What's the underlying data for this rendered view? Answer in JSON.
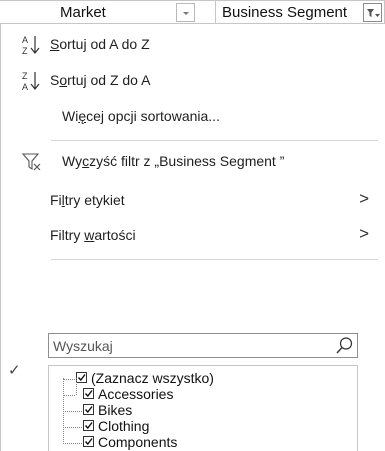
{
  "header": {
    "market_label": "Market",
    "segment_label": "Business Segment"
  },
  "menu": {
    "sort_az": {
      "pre": "",
      "acc": "S",
      "post": "ortuj od A do Z"
    },
    "sort_za": {
      "pre": "S",
      "acc": "o",
      "post": "rtuj od Z do A"
    },
    "more_sort": {
      "pre": "Wi",
      "acc": "ę",
      "post": "cej opcji sortowania..."
    },
    "clear_filter": {
      "pre": "Wy",
      "acc": "c",
      "post": "zyść filtr z „Business Segment ”"
    },
    "label_filters": {
      "pre": "Fi",
      "acc": "l",
      "post": "try etykiet"
    },
    "value_filters": {
      "pre": "Filtry ",
      "acc": "w",
      "post": "artości"
    },
    "chevron": ">"
  },
  "search": {
    "placeholder": "Wyszukaj"
  },
  "tree": {
    "checkmark": "✓",
    "items": [
      {
        "label": "(Zaznacz wszystko)",
        "checked": true
      },
      {
        "label": "Accessories",
        "checked": true
      },
      {
        "label": "Bikes",
        "checked": true
      },
      {
        "label": "Clothing",
        "checked": true
      },
      {
        "label": "Components",
        "checked": true
      }
    ]
  },
  "icons": {
    "sort_az": "sort-ascending-icon",
    "sort_za": "sort-descending-icon",
    "clear_filter": "clear-filter-icon",
    "search": "search-icon",
    "dropdown": "dropdown-arrow-icon",
    "filter_active": "filter-dropdown-icon"
  },
  "colors": {
    "border": "#c6c6c6",
    "text": "#1f1f1f"
  }
}
